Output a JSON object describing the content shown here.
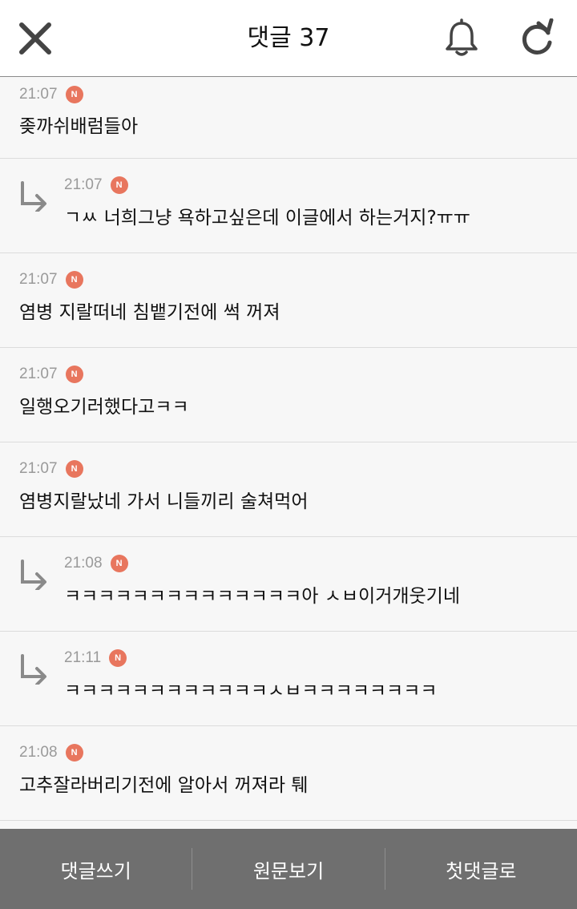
{
  "header": {
    "title": "댓글 37",
    "icons": {
      "close": "close-icon",
      "bell": "bell-icon",
      "refresh": "refresh-icon"
    }
  },
  "comments": [
    {
      "time": "21:07",
      "badge": "N",
      "text": "좆까쉬배럼들아",
      "reply": false
    },
    {
      "time": "21:07",
      "badge": "N",
      "text": "ㄱㅆ 너희그냥 욕하고싶은데 이글에서 하는거지?ㅠㅠ",
      "reply": true
    },
    {
      "time": "21:07",
      "badge": "N",
      "text": "염병 지랄떠네 침뱉기전에 썩 꺼져",
      "reply": false
    },
    {
      "time": "21:07",
      "badge": "N",
      "text": "일행오기러했다고ㅋㅋ",
      "reply": false
    },
    {
      "time": "21:07",
      "badge": "N",
      "text": "염병지랄났네 가서 니들끼리 술쳐먹어",
      "reply": false
    },
    {
      "time": "21:08",
      "badge": "N",
      "text": "ㅋㅋㅋㅋㅋㅋㅋㅋㅋㅋㅋㅋㅋㅋ아 ㅅㅂ이거개웃기네",
      "reply": true
    },
    {
      "time": "21:11",
      "badge": "N",
      "text": "ㅋㅋㅋㅋㅋㅋㅋㅋㅋㅋㅋㅋㅅㅂㅋㅋㅋㅋㅋㅋㅋㅋ",
      "reply": true
    },
    {
      "time": "21:08",
      "badge": "N",
      "text": "고추잘라버리기전에 알아서 꺼져라 퉤",
      "reply": false
    }
  ],
  "bottom": {
    "write": "댓글쓰기",
    "original": "원문보기",
    "first": "첫댓글로"
  },
  "colors": {
    "badge": "#e8765e",
    "bottom_bar": "#6f6f6f",
    "time": "#9a9a9a"
  }
}
